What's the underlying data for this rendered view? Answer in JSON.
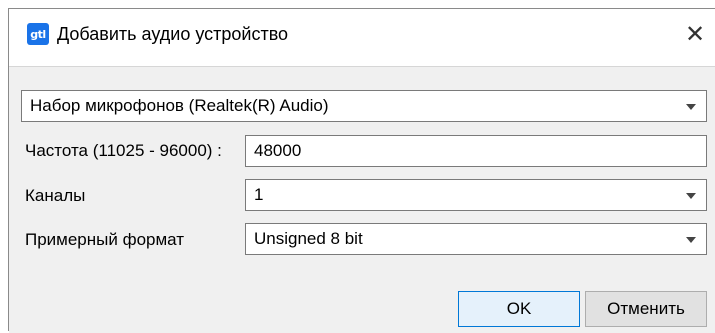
{
  "window": {
    "app_icon_text": "gtl",
    "title": "Добавить аудио устройство",
    "close_glyph": "✕"
  },
  "device": {
    "selected": "Набор микрофонов (Realtek(R) Audio)"
  },
  "frequency": {
    "label": "Частота (11025 - 96000) :",
    "value": "48000"
  },
  "channels": {
    "label": "Каналы",
    "selected": "1"
  },
  "format": {
    "label": "Примерный формат",
    "selected": "Unsigned 8 bit"
  },
  "buttons": {
    "ok": "OK",
    "cancel": "Отменить"
  },
  "colors": {
    "accent": "#0078d7",
    "icon": "#1a73e8"
  }
}
